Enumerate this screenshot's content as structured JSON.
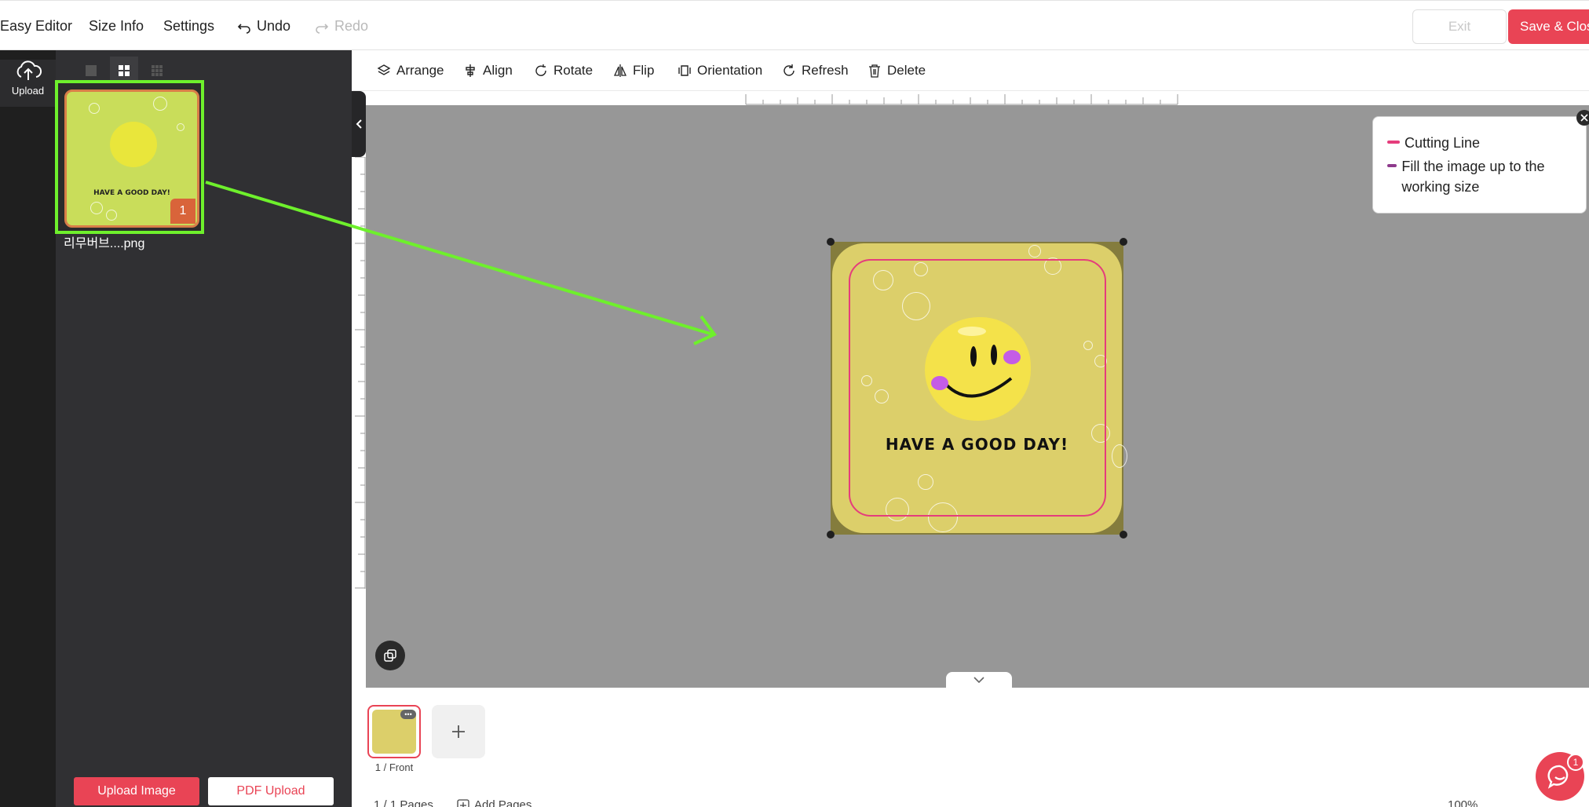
{
  "topbar": {
    "app_title": "Easy Editor",
    "size_info": "Size Info",
    "settings": "Settings",
    "undo": "Undo",
    "redo": "Redo",
    "exit": "Exit",
    "save_close": "Save & Close"
  },
  "rail": {
    "upload_label": "Upload"
  },
  "panel": {
    "thumb_badge": "1",
    "thumb_name": "리무버브....png",
    "thumb_text": "HAVE A GOOD DAY!",
    "upload_image": "Upload Image",
    "pdf_upload": "PDF Upload"
  },
  "toolbar": {
    "arrange": "Arrange",
    "align": "Align",
    "rotate": "Rotate",
    "flip": "Flip",
    "orientation": "Orientation",
    "refresh": "Refresh",
    "delete": "Delete"
  },
  "canvas": {
    "artwork_text": "HAVE A GOOD DAY!",
    "legend": {
      "cutting_line": "Cutting Line",
      "fill_hint": "Fill the image up to the working size",
      "cutting_color": "#e53d7c",
      "fill_color": "#8e3a8c"
    }
  },
  "pages": {
    "page_label": "1 / Front",
    "page_count": "1 / 1 Pages",
    "add_pages": "Add Pages",
    "zoom": "100%"
  },
  "chat": {
    "badge": "1"
  },
  "colors": {
    "accent": "#e94455",
    "highlight": "#6ef02c"
  }
}
